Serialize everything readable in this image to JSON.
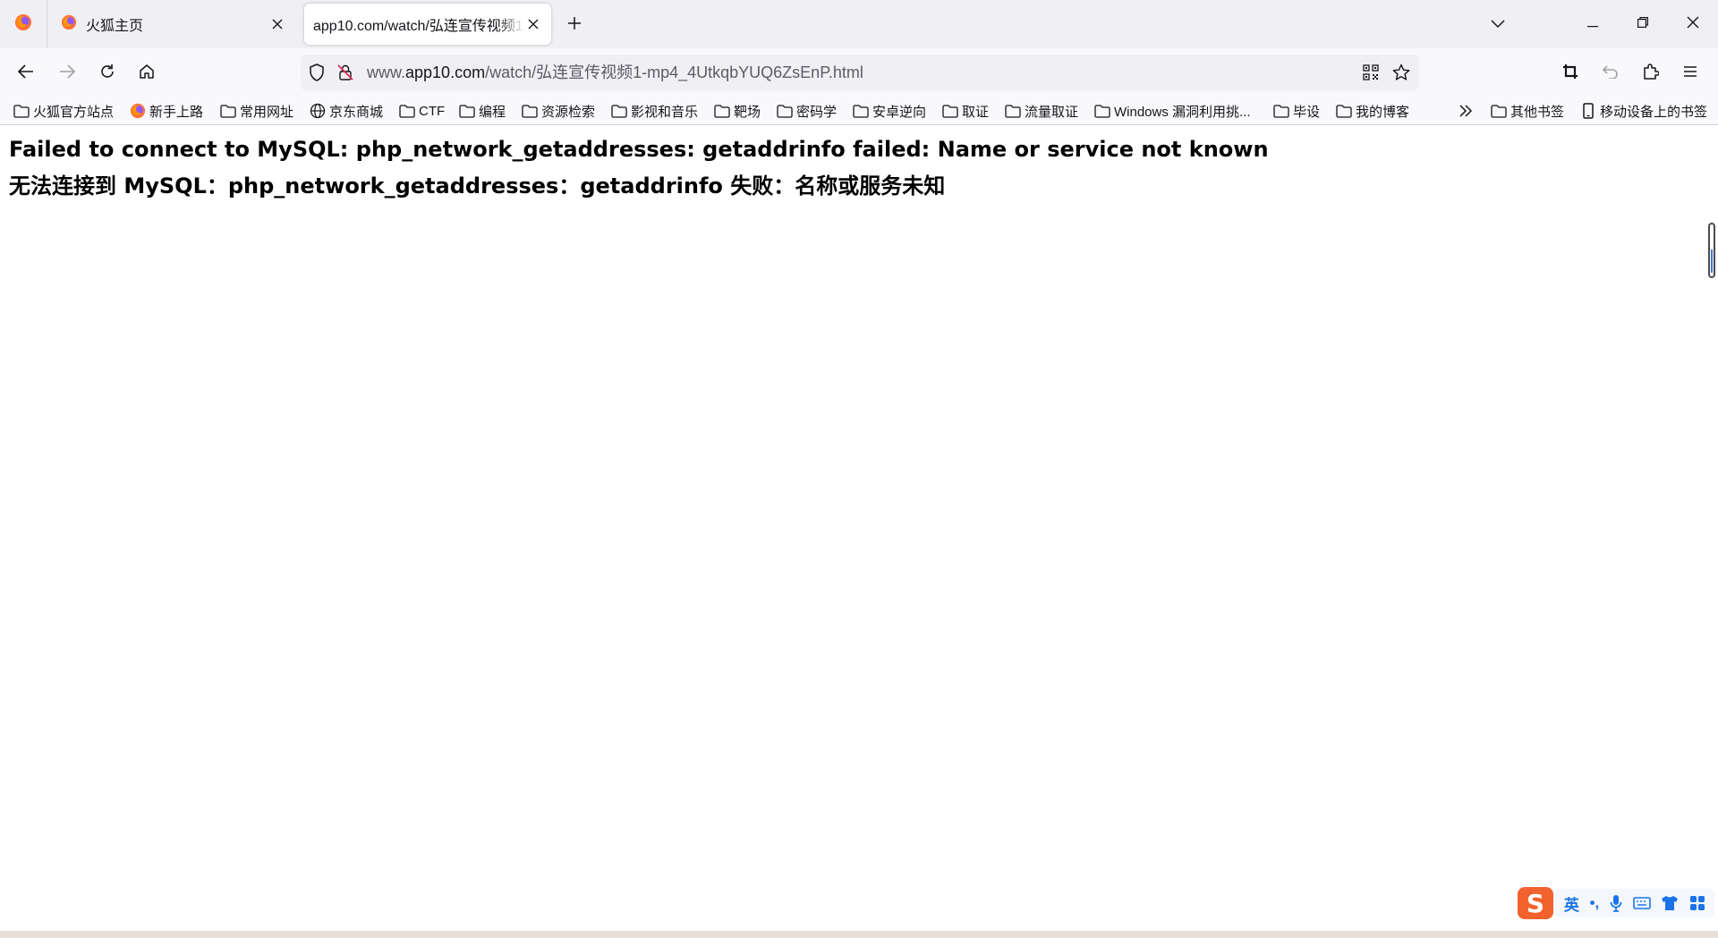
{
  "tabs": [
    {
      "title": "火狐主页",
      "icon": "firefox-icon",
      "active": false
    },
    {
      "title": "app10.com/watch/弘连宣传视频1-mp4_4UtkqbYUQ6ZsEnP.html",
      "icon": "none",
      "active": true
    }
  ],
  "url": {
    "prefix": "www.",
    "host": "app10.com",
    "path": "/watch/弘连宣传视频1-mp4_4UtkqbYUQ6ZsEnP.html"
  },
  "bookmarks": [
    {
      "label": "火狐官方站点",
      "icon": "folder-icon"
    },
    {
      "label": "新手上路",
      "icon": "firefox-icon"
    },
    {
      "label": "常用网址",
      "icon": "folder-icon"
    },
    {
      "label": "京东商城",
      "icon": "globe-icon"
    },
    {
      "label": "CTF",
      "icon": "folder-icon"
    },
    {
      "label": "编程",
      "icon": "folder-icon"
    },
    {
      "label": "资源检索",
      "icon": "folder-icon"
    },
    {
      "label": "影视和音乐",
      "icon": "folder-icon"
    },
    {
      "label": "靶场",
      "icon": "folder-icon"
    },
    {
      "label": "密码学",
      "icon": "folder-icon"
    },
    {
      "label": "安卓逆向",
      "icon": "folder-icon"
    },
    {
      "label": "取证",
      "icon": "folder-icon"
    },
    {
      "label": "流量取证",
      "icon": "folder-icon"
    },
    {
      "label": "Windows 漏洞利用挑...",
      "icon": "folder-icon"
    },
    {
      "label": "毕设",
      "icon": "folder-icon"
    },
    {
      "label": "我的博客",
      "icon": "folder-icon"
    }
  ],
  "bookmarks_right": [
    {
      "label": "其他书签",
      "icon": "folder-icon"
    },
    {
      "label": "移动设备上的书签",
      "icon": "mobile-icon"
    }
  ],
  "page": {
    "error_en": "Failed to connect to MySQL: php_network_getaddresses: getaddrinfo failed: Name or service not known",
    "error_zh": "无法连接到 MySQL：php_network_getaddresses：getaddrinfo 失败：名称或服务未知"
  },
  "ime": {
    "logo": "S",
    "mode": "英",
    "punct": "•,"
  },
  "colors": {
    "tabstrip_bg": "#f0f0f4",
    "toolbar_bg": "#f9f9fb",
    "ime_accent": "#1a73e8",
    "ime_logo": "#f2622e"
  }
}
